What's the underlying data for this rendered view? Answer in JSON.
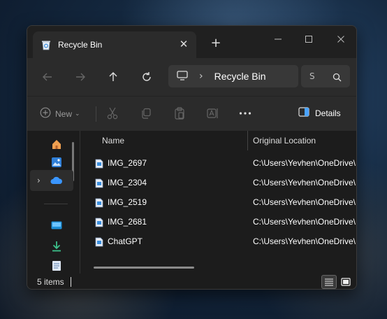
{
  "window": {
    "tab_title": "Recycle Bin",
    "tab_close": "✕",
    "new_tab": "+"
  },
  "nav": {
    "breadcrumb_sep": "›",
    "address": "Recycle Bin",
    "search_placeholder": "S"
  },
  "command_bar": {
    "new_label": "New",
    "new_chevron": "⌄",
    "details_label": "Details"
  },
  "columns": {
    "name": "Name",
    "original_location": "Original Location",
    "sort_indicator": "^"
  },
  "files": [
    {
      "name": "IMG_2697",
      "location": "C:\\Users\\Yevhen\\OneDrive\\I"
    },
    {
      "name": "IMG_2304",
      "location": "C:\\Users\\Yevhen\\OneDrive\\I"
    },
    {
      "name": "IMG_2519",
      "location": "C:\\Users\\Yevhen\\OneDrive\\I"
    },
    {
      "name": "IMG_2681",
      "location": "C:\\Users\\Yevhen\\OneDrive\\I"
    },
    {
      "name": "ChatGPT",
      "location": "C:\\Users\\Yevhen\\OneDrive\\I"
    }
  ],
  "sidebar": {
    "expand_chevron": "›"
  },
  "status": {
    "count": "5 items"
  },
  "colors": {
    "window_bg": "#1c1c1c",
    "toolbar_bg": "#2b2b2b",
    "accent_blue": "#4aa3ff",
    "download_green": "#3cc08a"
  }
}
